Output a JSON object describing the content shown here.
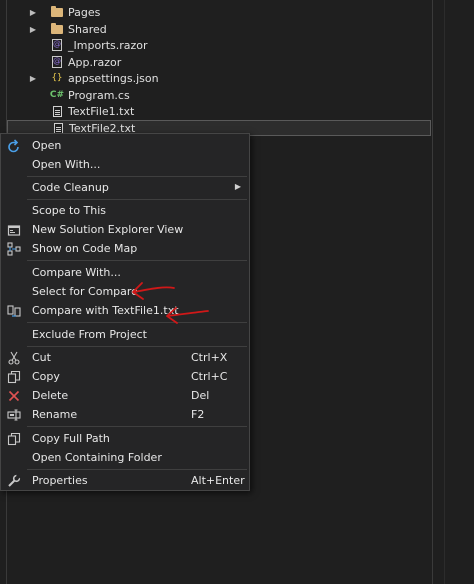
{
  "tree": [
    {
      "label": "Pages",
      "icon": "folder-icon",
      "expandable": true
    },
    {
      "label": "Shared",
      "icon": "folder-icon",
      "expandable": true
    },
    {
      "label": "_Imports.razor",
      "icon": "razor-file-icon",
      "expandable": false
    },
    {
      "label": "App.razor",
      "icon": "razor-file-icon",
      "expandable": false
    },
    {
      "label": "appsettings.json",
      "icon": "json-file-icon",
      "expandable": true
    },
    {
      "label": "Program.cs",
      "icon": "csharp-file-icon",
      "expandable": false
    },
    {
      "label": "TextFile1.txt",
      "icon": "text-file-icon",
      "expandable": false
    },
    {
      "label": "TextFile2.txt",
      "icon": "text-file-icon",
      "expandable": false,
      "selected": true
    }
  ],
  "menu": {
    "open": "Open",
    "open_with": "Open With...",
    "code_cleanup": "Code Cleanup",
    "scope_to_this": "Scope to This",
    "new_solution_explorer_view": "New Solution Explorer View",
    "show_on_code_map": "Show on Code Map",
    "compare_with": "Compare With...",
    "select_for_compare": "Select for Compare",
    "compare_with_textfile1": "Compare with TextFile1.txt",
    "exclude_from_project": "Exclude From Project",
    "cut": "Cut",
    "cut_shortcut": "Ctrl+X",
    "copy": "Copy",
    "copy_shortcut": "Ctrl+C",
    "delete": "Delete",
    "delete_shortcut": "Del",
    "rename": "Rename",
    "rename_shortcut": "F2",
    "copy_full_path": "Copy Full Path",
    "open_containing_folder": "Open Containing Folder",
    "properties": "Properties",
    "properties_shortcut": "Alt+Enter"
  },
  "colors": {
    "background": "#1f1f1f",
    "menu_background": "#252526",
    "folder": "#dcb67a",
    "annotation_arrow": "#d01818",
    "accent_blue": "#4a9fe8",
    "delete_red": "#e05252"
  }
}
